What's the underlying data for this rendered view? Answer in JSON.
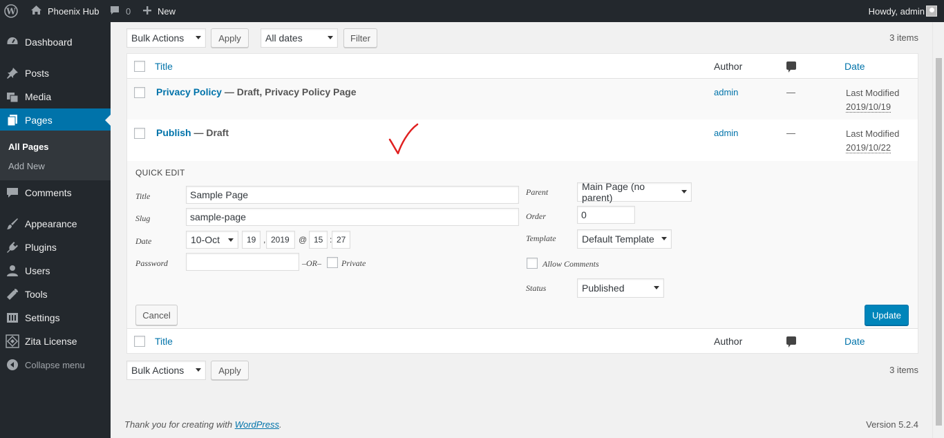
{
  "adminbar": {
    "site_name": "Phoenix Hub",
    "comments_count": "0",
    "new_label": "New",
    "howdy": "Howdy, admin"
  },
  "sidebar": {
    "items": [
      {
        "label": "Dashboard",
        "icon": "dashboard-icon"
      },
      {
        "label": "Posts",
        "icon": "pin-icon"
      },
      {
        "label": "Media",
        "icon": "media-icon"
      },
      {
        "label": "Pages",
        "icon": "pages-icon"
      },
      {
        "label": "Comments",
        "icon": "comment-icon"
      },
      {
        "label": "Appearance",
        "icon": "brush-icon"
      },
      {
        "label": "Plugins",
        "icon": "plug-icon"
      },
      {
        "label": "Users",
        "icon": "users-icon"
      },
      {
        "label": "Tools",
        "icon": "wrench-icon"
      },
      {
        "label": "Settings",
        "icon": "settings-icon"
      },
      {
        "label": "Zita License",
        "icon": "zita-icon"
      }
    ],
    "submenu": [
      "All Pages",
      "Add New"
    ],
    "collapse": "Collapse menu"
  },
  "tablenav_top": {
    "bulk_actions": "Bulk Actions",
    "apply": "Apply",
    "dates": "All dates",
    "filter": "Filter",
    "count": "3 items"
  },
  "table": {
    "columns": {
      "title": "Title",
      "author": "Author",
      "date": "Date"
    },
    "rows": [
      {
        "title": "Privacy Policy",
        "state": " — Draft, Privacy Policy Page",
        "author": "admin",
        "comments": "—",
        "date_label": "Last Modified",
        "date": "2019/10/19"
      },
      {
        "title": "Publish",
        "state": " — Draft",
        "author": "admin",
        "comments": "—",
        "date_label": "Last Modified",
        "date": "2019/10/22"
      }
    ]
  },
  "quick_edit": {
    "heading": "QUICK EDIT",
    "labels": {
      "title": "Title",
      "slug": "Slug",
      "date": "Date",
      "password": "Password",
      "or": "–OR–",
      "private": "Private",
      "parent": "Parent",
      "order": "Order",
      "template": "Template",
      "allow_comments": "Allow Comments",
      "status": "Status"
    },
    "values": {
      "title": "Sample Page",
      "slug": "sample-page",
      "month": "10-Oct",
      "day": "19",
      "year": "2019",
      "hour": "15",
      "minute": "27",
      "password": "",
      "parent": "Main Page (no parent)",
      "order": "0",
      "template": "Default Template",
      "status": "Published"
    },
    "date_sep_comma": ",",
    "date_sep_at": "@",
    "date_sep_colon": ":",
    "cancel": "Cancel",
    "update": "Update"
  },
  "tablenav_bottom": {
    "bulk_actions": "Bulk Actions",
    "apply": "Apply",
    "count": "3 items"
  },
  "footer": {
    "thanks_prefix": "Thank you for creating with ",
    "wordpress": "WordPress",
    "thanks_suffix": ".",
    "version": "Version 5.2.4"
  },
  "colors": {
    "accent": "#0073aa",
    "primary_button": "#0085ba",
    "annotation": "#e02020"
  }
}
